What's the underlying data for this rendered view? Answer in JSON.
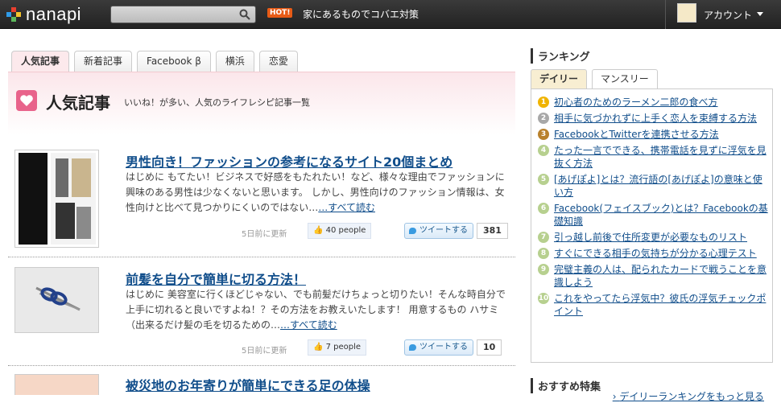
{
  "header": {
    "logo_text": "nanapi",
    "search_placeholder": "",
    "hot_badge": "HOT!",
    "hot_text": "家にあるものでコバエ対策",
    "account_label": "アカウント"
  },
  "tabs": [
    {
      "label": "人気記事"
    },
    {
      "label": "新着記事"
    },
    {
      "label": "Facebook β"
    },
    {
      "label": "横浜"
    },
    {
      "label": "恋愛"
    }
  ],
  "banner": {
    "title": "人気記事",
    "subtitle": "いいね！が多い、人気のライフレシピ記事一覧"
  },
  "articles": [
    {
      "title": "男性向き！ファッションの参考になるサイト20個まとめ",
      "body": "はじめに もてたい！ビジネスで好感をもたれたい！など、様々な理由でファッションに興味のある男性は少なくないと思います。 しかし、男性向けのファッション情報は、女性向けと比べて見つかりにくいのではない…",
      "more": "…すべて読む",
      "date": "5日前に更新",
      "likes": "40 people",
      "tweet_label": "ツイートする",
      "tweet_count": "381"
    },
    {
      "title": "前髪を自分で簡単に切る方法！",
      "body": "はじめに 美容室に行くほどじゃない、でも前髪だけちょっと切りたい！そんな時自分で上手に切れると良いですよね！？その方法をお教えいたします！ 用意するもの ハサミ（出来るだけ髪の毛を切るための…",
      "more": "…すべて読む",
      "date": "5日前に更新",
      "likes": "7 people",
      "tweet_label": "ツイートする",
      "tweet_count": "10"
    },
    {
      "title": "被災地のお年寄りが簡単にできる足の体操"
    }
  ],
  "sidebar": {
    "ranking_heading": "ランキング",
    "tabs": [
      {
        "label": "デイリー"
      },
      {
        "label": "マンスリー"
      }
    ],
    "ranking": [
      {
        "num": "1",
        "title": "初心者のためのラーメン二郎の食べ方",
        "color": "#f0b400"
      },
      {
        "num": "2",
        "title": "相手に気づかれずに上手く恋人を束縛する方法",
        "color": "#a8a8a8"
      },
      {
        "num": "3",
        "title": "FacebookとTwitterを連携させる方法",
        "color": "#b9812c"
      },
      {
        "num": "4",
        "title": "たった一言でできる、携帯電話を見ずに浮気を見抜く方法",
        "color": "#b7d08f"
      },
      {
        "num": "5",
        "title": "[あげぽよ]とは？流行語の[あげぽよ]の意味と使い方",
        "color": "#b7d08f"
      },
      {
        "num": "6",
        "title": "Facebook(フェイスブック)とは？Facebookの基礎知識",
        "color": "#b7d08f"
      },
      {
        "num": "7",
        "title": "引っ越し前後で住所変更が必要なものリスト",
        "color": "#b7d08f"
      },
      {
        "num": "8",
        "title": "すぐにできる相手の気持ちが分かる心理テスト",
        "color": "#b7d08f"
      },
      {
        "num": "9",
        "title": "完璧主義の人は、配られたカードで戦うことを意識しよう",
        "color": "#b7d08f"
      },
      {
        "num": "10",
        "title": "これをやってたら浮気中？彼氏の浮気チェックポイント",
        "color": "#b7d08f"
      }
    ],
    "more_ranking": "デイリーランキングをもっと見る",
    "featured_heading": "おすすめ特集"
  }
}
